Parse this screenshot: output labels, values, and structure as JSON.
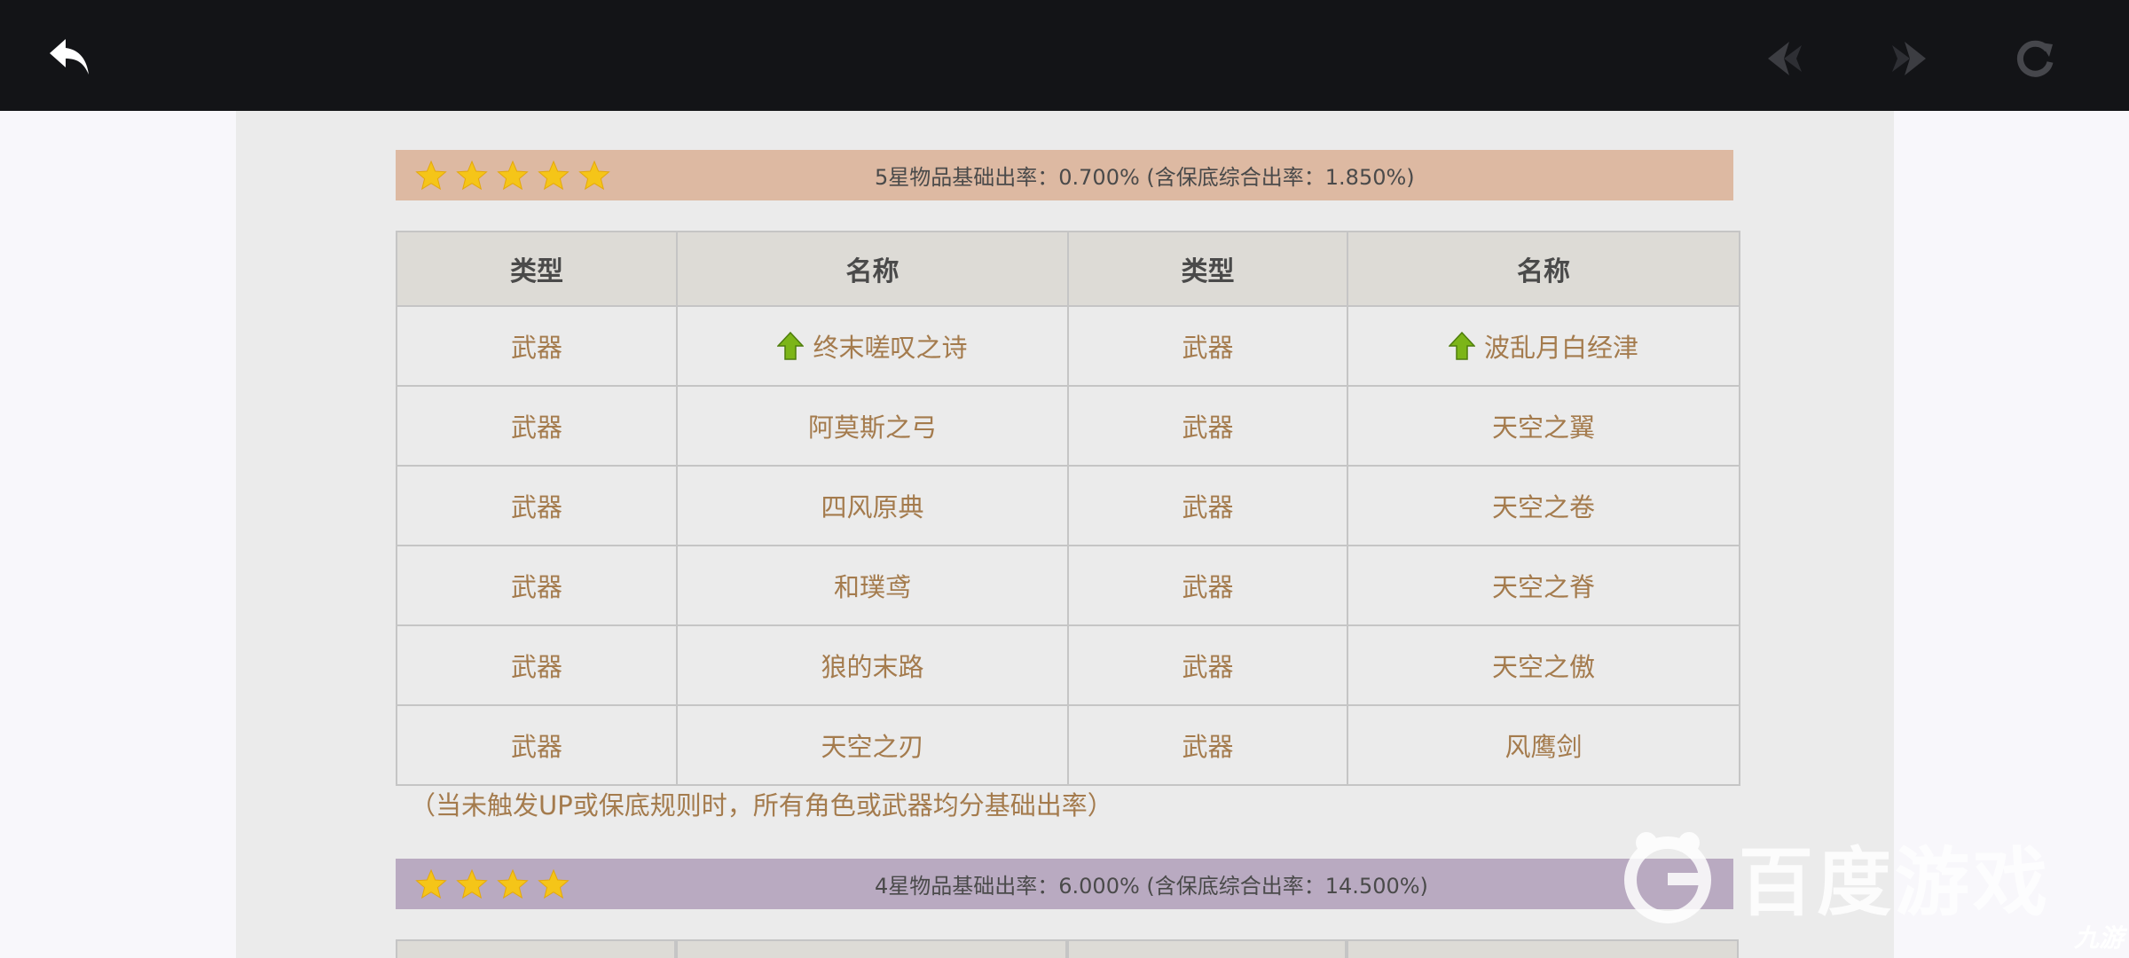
{
  "nav": {
    "back_icon": "back-arrow-icon",
    "prev_icon": "prev-arrow-icon",
    "next_icon": "next-arrow-icon",
    "refresh_icon": "refresh-icon"
  },
  "five_star": {
    "stars": 5,
    "rate_text": "5星物品基础出率：0.700% (含保底综合出率：1.850%)",
    "color": "#ddb9a2"
  },
  "table": {
    "headers": [
      "类型",
      "名称",
      "类型",
      "名称"
    ],
    "rows": [
      {
        "type1": "武器",
        "name1": "终末嗟叹之诗",
        "up1": true,
        "type2": "武器",
        "name2": "波乱月白经津",
        "up2": true
      },
      {
        "type1": "武器",
        "name1": "阿莫斯之弓",
        "up1": false,
        "type2": "武器",
        "name2": "天空之翼",
        "up2": false
      },
      {
        "type1": "武器",
        "name1": "四风原典",
        "up1": false,
        "type2": "武器",
        "name2": "天空之卷",
        "up2": false
      },
      {
        "type1": "武器",
        "name1": "和璞鸢",
        "up1": false,
        "type2": "武器",
        "name2": "天空之脊",
        "up2": false
      },
      {
        "type1": "武器",
        "name1": "狼的末路",
        "up1": false,
        "type2": "武器",
        "name2": "天空之傲",
        "up2": false
      },
      {
        "type1": "武器",
        "name1": "天空之刃",
        "up1": false,
        "type2": "武器",
        "name2": "风鹰剑",
        "up2": false
      }
    ]
  },
  "note": "（当未触发UP或保底规则时，所有角色或武器均分基础出率）",
  "four_star": {
    "stars": 4,
    "rate_text": "4星物品基础出率：6.000% (含保底综合出率：14.500%)",
    "color": "#b9aac1"
  },
  "watermark": {
    "text": "百度游戏",
    "corner": "九游"
  }
}
